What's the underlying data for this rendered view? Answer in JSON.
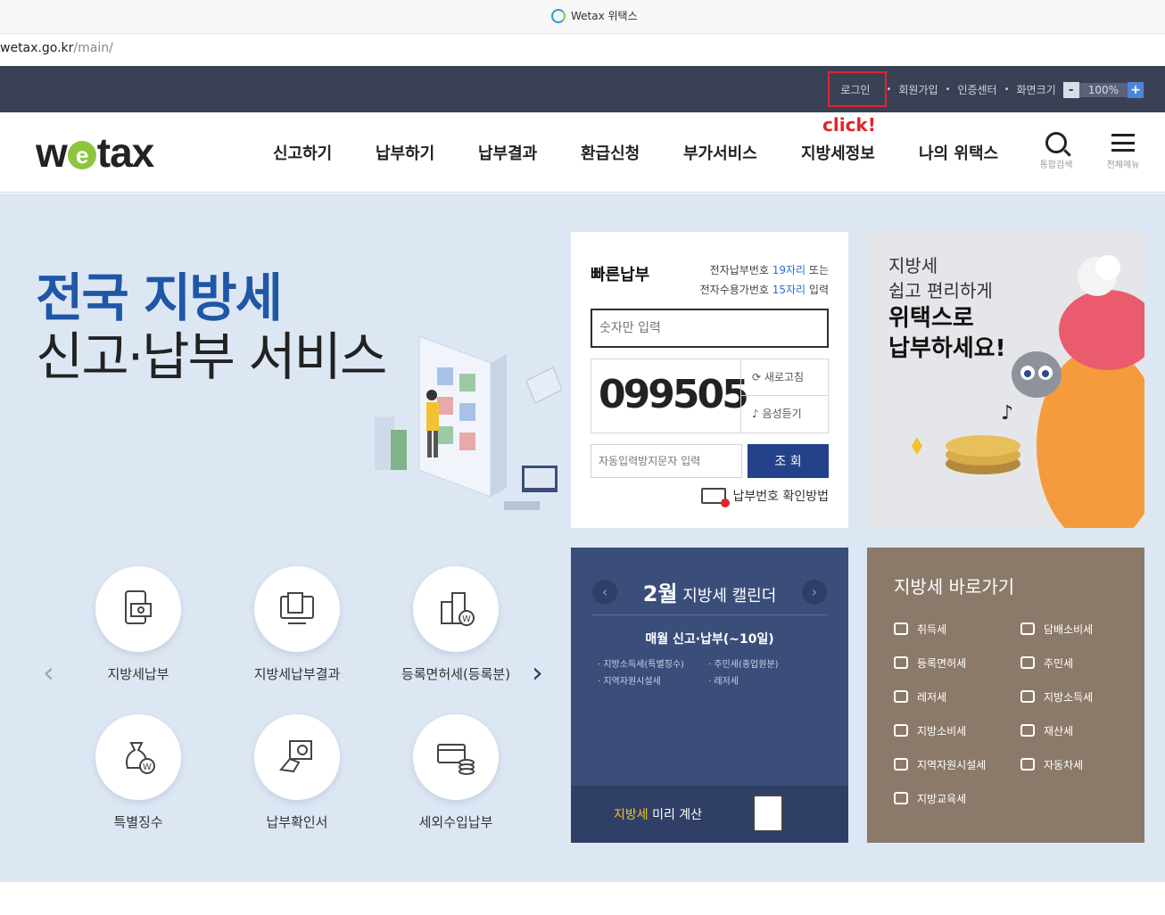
{
  "browser": {
    "tab_title": "Wetax 위택스",
    "url_host": "wetax.go.kr",
    "url_path": "/main/"
  },
  "utility": {
    "login": "로그인",
    "signup": "회원가입",
    "cert_center": "인증센터",
    "screen_size": "화면크기",
    "zoom_minus": "-",
    "zoom_value": "100%",
    "zoom_plus": "+"
  },
  "annotation": {
    "click": "click!"
  },
  "nav": {
    "logo_w": "w",
    "logo_e": "e",
    "logo_tax": "tax",
    "menu": [
      "신고하기",
      "납부하기",
      "납부결과",
      "환급신청",
      "부가서비스",
      "지방세정보",
      "나의 위택스"
    ],
    "search_label": "통합검색",
    "allmenu_label": "전체메뉴"
  },
  "hero": {
    "title_line1": "전국 지방세",
    "title_line2": "신고·납부 서비스"
  },
  "services": [
    {
      "label": "지방세납부",
      "icon": "mobile-payment-icon"
    },
    {
      "label": "지방세납부결과",
      "icon": "document-result-icon"
    },
    {
      "label": "등록면허세(등록분)",
      "icon": "building-won-icon"
    },
    {
      "label": "특별징수",
      "icon": "money-bag-icon"
    },
    {
      "label": "납부확인서",
      "icon": "certificate-hand-icon"
    },
    {
      "label": "세외수입납부",
      "icon": "card-coins-icon"
    }
  ],
  "quickpay": {
    "title": "빠른납부",
    "desc1_pre": "전자납부번호 ",
    "desc1_hl": "19자리",
    "desc1_post": " 또는",
    "desc2_pre": "전자수용가번호 ",
    "desc2_hl": "15자리",
    "desc2_post": " 입력",
    "input_placeholder": "숫자만 입력",
    "captcha_code": "099505",
    "refresh": "새로고침",
    "audio": "음성듣기",
    "captcha_placeholder": "자동입력방지문자 입력",
    "lookup": "조 회",
    "howto": "납부번호 확인방법"
  },
  "promo": {
    "line1": "지방세",
    "line2": "쉽고 편리하게",
    "line3": "위택스로",
    "line4": "납부하세요!"
  },
  "calendar": {
    "month": "2월",
    "title": " 지방세 캘린더",
    "sub": "매월 신고·납부(~10일)",
    "items": [
      "· 지방소득세(특별징수)",
      "· 주민세(종업원분)",
      "· 지역자원시설세",
      "· 레저세"
    ],
    "footer_hl": "지방세",
    "footer_rest": " 미리 계산"
  },
  "shortcuts": {
    "title": "지방세 바로가기",
    "items": [
      "취득세",
      "담배소비세",
      "등록면허세",
      "주민세",
      "레저세",
      "지방소득세",
      "지방소비세",
      "재산세",
      "지역자원시설세",
      "자동차세",
      "지방교육세"
    ]
  },
  "colors": {
    "utility_bg": "#3b4155",
    "brand_blue": "#1f57a6",
    "hero_bg": "#dde7f4",
    "calendar_bg": "#3b4e7a",
    "shortcut_bg": "#8b7a69",
    "highlight_red": "#e0252b",
    "logo_green": "#8cc63f"
  }
}
